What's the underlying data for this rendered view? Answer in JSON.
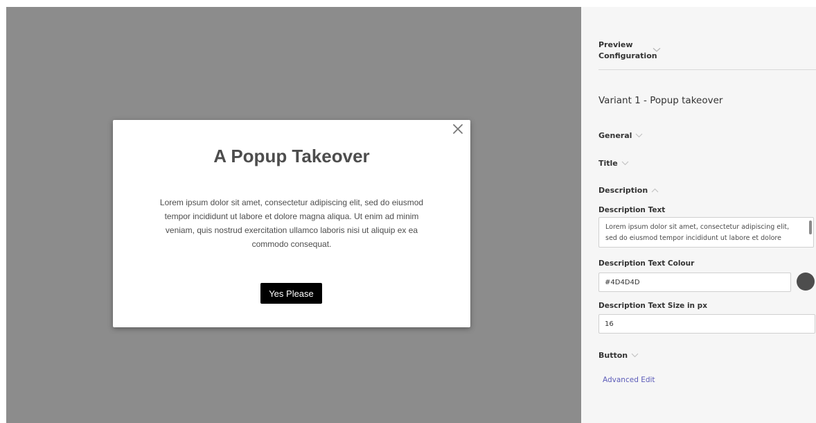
{
  "popup": {
    "title": "A Popup Takeover",
    "description": "Lorem ipsum dolor sit amet, consectetur adipiscing elit, sed do eiusmod tempor incididunt ut labore et dolore magna aliqua. Ut enim ad minim veniam, quis nostrud exercitation ullamco laboris nisi ut aliquip ex ea commodo consequat.",
    "button_label": "Yes Please",
    "close_icon": "close-icon",
    "title_color": "#4D4D4D",
    "description_color": "#4D4D4D",
    "button_color": "#000000"
  },
  "preview": {
    "background_color": "#8c8c8c"
  },
  "sidebar": {
    "preview_configuration": "Preview Configuration",
    "variant_title": "Variant 1 - Popup takeover",
    "sections": {
      "general": "General",
      "title": "Title",
      "description": "Description",
      "button": "Button"
    },
    "description_text_label": "Description Text",
    "description_text_value": "Lorem ipsum dolor sit amet, consectetur adipiscing elit, sed do eiusmod tempor incididunt ut labore et dolore magna",
    "description_colour_label": "Description Text Colour",
    "description_colour_value": "#4D4D4D",
    "description_size_label": "Description Text Size in px",
    "description_size_value": "16",
    "advanced_edit": "Advanced Edit",
    "accent_color": "#5b5bb8"
  }
}
